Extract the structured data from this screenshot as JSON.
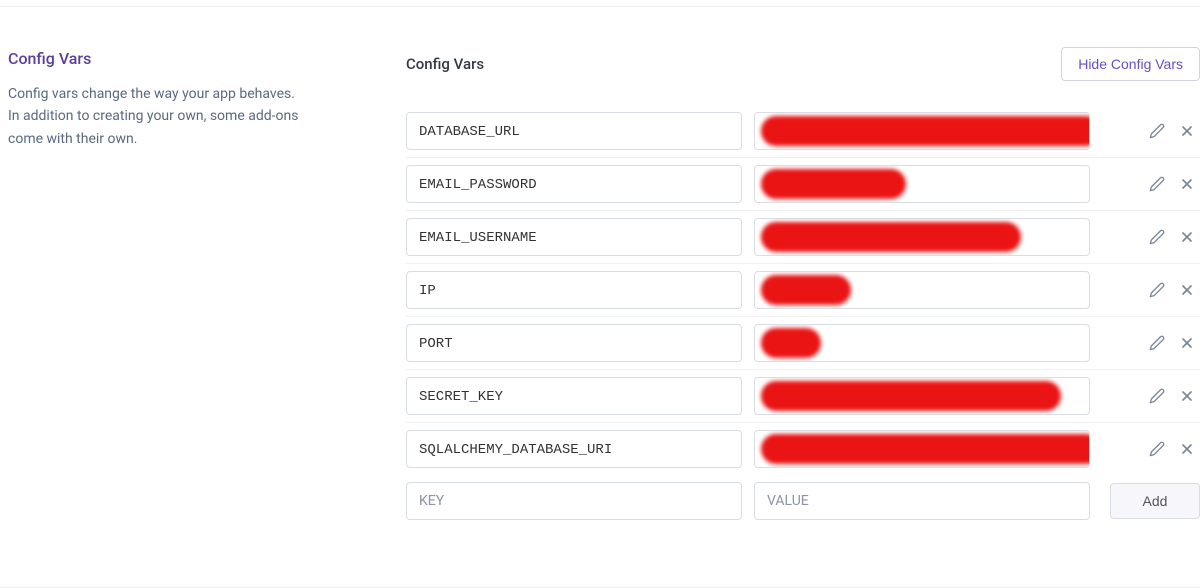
{
  "sidebar": {
    "title": "Config Vars",
    "description": "Config vars change the way your app behaves. In addition to creating your own, some add-ons come with their own."
  },
  "main": {
    "heading": "Config Vars",
    "toggle_button": "Hide Config Vars",
    "add_button": "Add",
    "new_key_placeholder": "KEY",
    "new_value_placeholder": "VALUE"
  },
  "config_vars": [
    {
      "key": "DATABASE_URL",
      "redact_width": 340
    },
    {
      "key": "EMAIL_PASSWORD",
      "redact_width": 145
    },
    {
      "key": "EMAIL_USERNAME",
      "redact_width": 260
    },
    {
      "key": "IP",
      "redact_width": 90
    },
    {
      "key": "PORT",
      "redact_width": 60
    },
    {
      "key": "SECRET_KEY",
      "redact_width": 300
    },
    {
      "key": "SQLALCHEMY_DATABASE_URI",
      "redact_width": 340
    }
  ]
}
